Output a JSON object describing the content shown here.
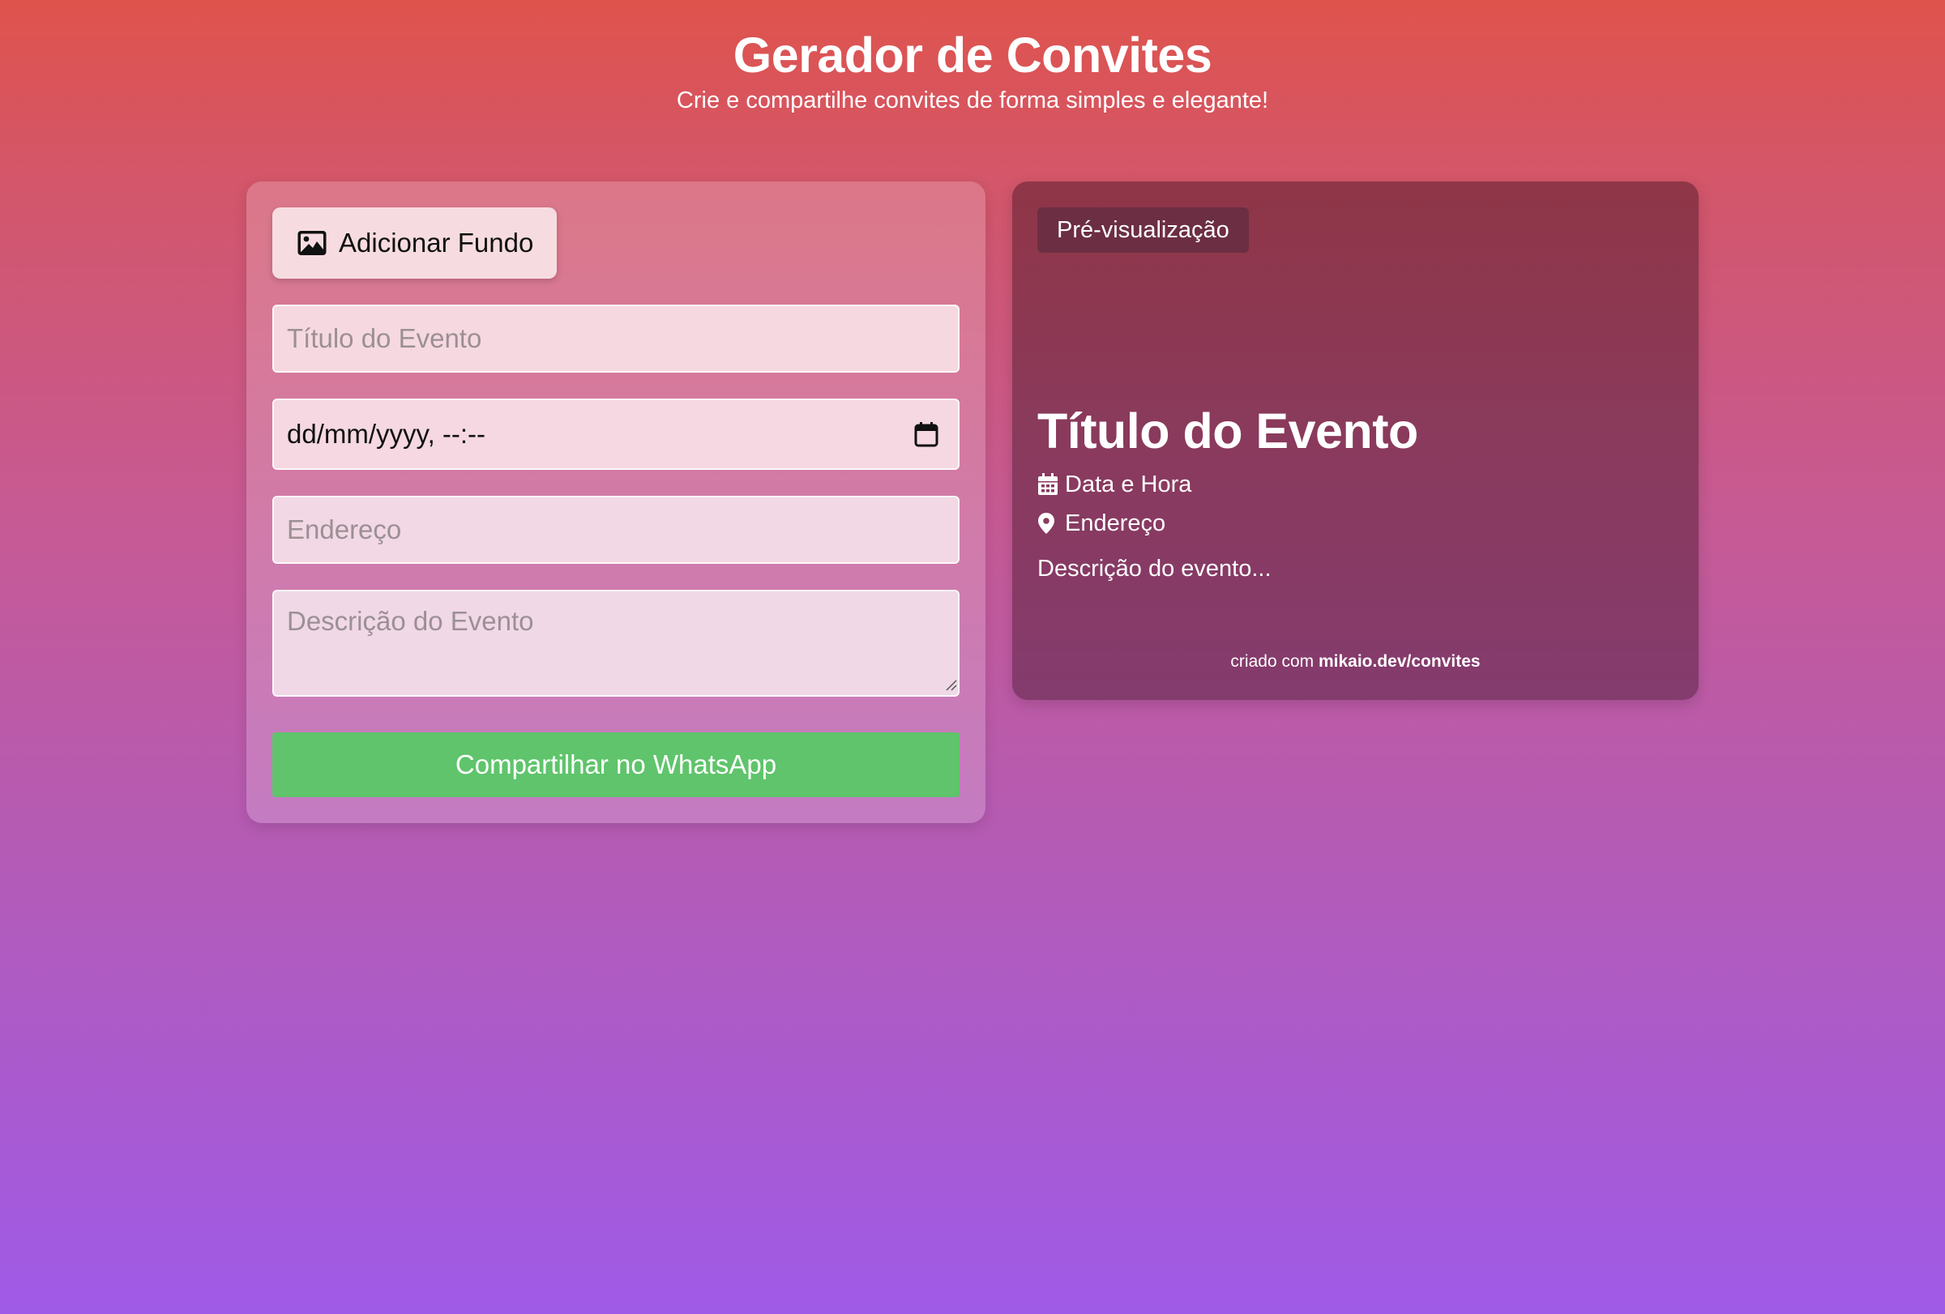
{
  "header": {
    "title": "Gerador de Convites",
    "subtitle": "Crie e compartilhe convites de forma simples e elegante!"
  },
  "form": {
    "background_button_label": "Adicionar Fundo",
    "background_button_icon": "image-icon",
    "title_placeholder": "Título do Evento",
    "datetime_value": "dd/mm/yyyy, --:--",
    "datetime_icon": "calendar-icon",
    "address_placeholder": "Endereço",
    "description_placeholder": "Descrição do Evento",
    "share_button_label": "Compartilhar no WhatsApp",
    "share_button_color": "#5fc46b"
  },
  "preview": {
    "badge": "Pré-visualização",
    "title": "Título do Evento",
    "date_label": "Data e Hora",
    "date_icon": "calendar-icon",
    "address_label": "Endereço",
    "address_icon": "map-pin-icon",
    "description": "Descrição do evento...",
    "footer_prefix": "criado com",
    "footer_link": "mikaio.dev/convites"
  }
}
